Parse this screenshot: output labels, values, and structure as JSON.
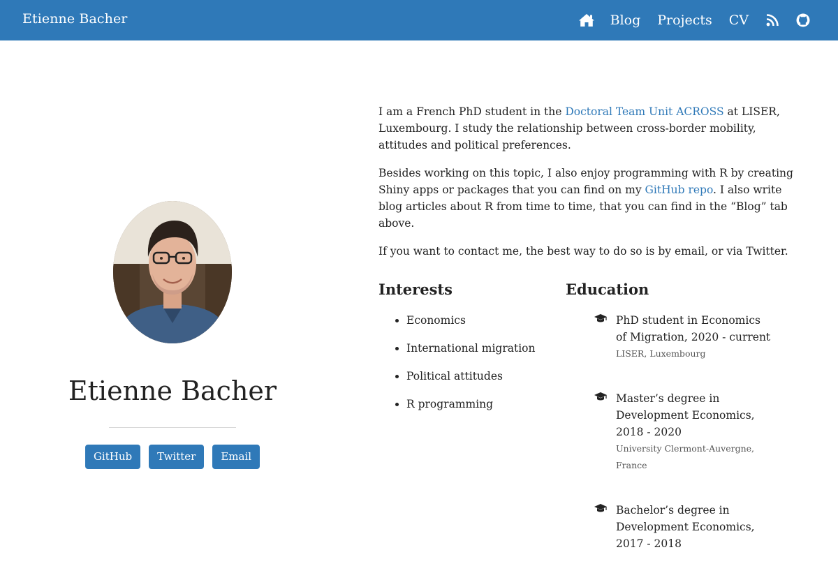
{
  "navbar": {
    "brand": "Etienne Bacher",
    "links": [
      "Blog",
      "Projects",
      "CV"
    ],
    "icons": [
      "home-icon",
      "rss-icon",
      "github-icon"
    ],
    "background": "#2f79b8"
  },
  "profile": {
    "name": "Etienne Bacher",
    "buttons": [
      "GitHub",
      "Twitter",
      "Email"
    ]
  },
  "about": {
    "p1_a": "I am a French PhD student in the ",
    "p1_link": "Doctoral Team Unit ACROSS",
    "p1_b": " at LISER, Luxembourg. I study the relationship between cross-border mobility, attitudes and political preferences.",
    "p2_a": "Besides working on this topic, I also enjoy programming with R by creating Shiny apps or packages that you can find on my ",
    "p2_link": "GitHub repo",
    "p2_b": ". I also write blog articles about R from time to time, that you can find in the “Blog” tab above.",
    "p3": "If you want to contact me, the best way to do so is by email, or via Twitter."
  },
  "interests": {
    "title": "Interests",
    "items": [
      "Economics",
      "International migration",
      "Political attitudes",
      "R programming"
    ]
  },
  "education": {
    "title": "Education",
    "items": [
      {
        "degree": "PhD student in Economics of Migration, 2020 - current",
        "institution": "LISER, Luxembourg"
      },
      {
        "degree": "Master’s degree in Development Economics, 2018 - 2020",
        "institution": "University Clermont-Auvergne, France"
      },
      {
        "degree": "Bachelor’s degree in Development Economics, 2017 - 2018",
        "institution": ""
      }
    ]
  },
  "colors": {
    "accent": "#2f79b8",
    "text": "#222222"
  }
}
